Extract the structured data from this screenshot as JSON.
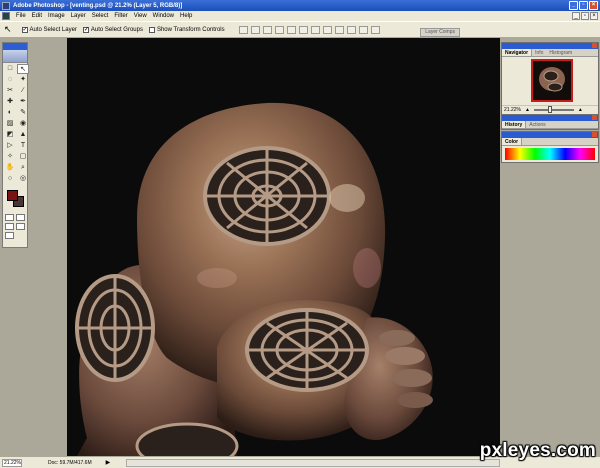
{
  "window": {
    "title": "Adobe Photoshop - [venting.psd @ 21.2% (Layer 5, RGB/8)]"
  },
  "menu": [
    "File",
    "Edit",
    "Image",
    "Layer",
    "Select",
    "Filter",
    "View",
    "Window",
    "Help"
  ],
  "options": {
    "tool_glyph": "↖",
    "auto_select_layer": {
      "label": "Auto Select Layer",
      "checked": true
    },
    "auto_select_groups": {
      "label": "Auto Select Groups",
      "checked": true
    },
    "show_transform_controls": {
      "label": "Show Transform Controls",
      "checked": false
    },
    "palette_well_tab": "Layer Comps"
  },
  "toolbox": {
    "tools": [
      "□",
      "↖",
      "◌",
      "✦",
      "✂",
      "∕",
      "✚",
      "✒",
      "◐",
      "✎",
      "▨",
      "◉",
      "◩",
      "▲",
      "▷",
      "T",
      "✧",
      "▢",
      "✋",
      "⌕",
      "○",
      "◎"
    ],
    "foreground_color": "#7a1414",
    "background_color": "#4a3434"
  },
  "navigator": {
    "tabs": [
      "Navigator",
      "Info",
      "Histogram"
    ],
    "zoom": "21.22%"
  },
  "history": {
    "tabs": [
      "History",
      "Actions"
    ]
  },
  "color_panel": {
    "tabs": [
      "Color"
    ]
  },
  "status": {
    "zoom": "21.22%",
    "doc": "Doc: 59.7M/417.6M",
    "arrow": "▶"
  },
  "watermark": "pxleyes.com"
}
